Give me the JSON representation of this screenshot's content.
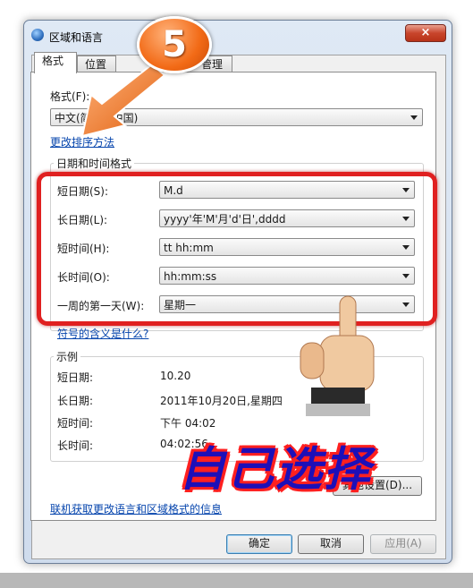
{
  "window": {
    "title": "区域和语言",
    "close_glyph": "×"
  },
  "tabs": [
    {
      "label": "格式"
    },
    {
      "label": "位置"
    },
    {
      "label": "管理"
    }
  ],
  "format": {
    "label": "格式(F):",
    "value": "中文(简体，中国)",
    "sort_link": "更改排序方法"
  },
  "datetime_group": {
    "title": "日期和时间格式",
    "rows": [
      {
        "label": "短日期(S):",
        "value": "M.d"
      },
      {
        "label": "长日期(L):",
        "value": "yyyy'年'M'月'd'日',dddd"
      },
      {
        "label": "短时间(H):",
        "value": "tt hh:mm"
      },
      {
        "label": "长时间(O):",
        "value": "hh:mm:ss"
      },
      {
        "label": "一周的第一天(W):",
        "value": "星期一"
      }
    ],
    "notation_link": "符号的含义是什么?"
  },
  "examples": {
    "title": "示例",
    "rows": [
      {
        "label": "短日期:",
        "value": "10.20"
      },
      {
        "label": "长日期:",
        "value": "2011年10月20日,星期四"
      },
      {
        "label": "短时间:",
        "value": "下午 04:02"
      },
      {
        "label": "长时间:",
        "value": "04:02:56"
      }
    ]
  },
  "other_settings_button": "其他设置(D)...",
  "online_link": "联机获取更改语言和区域格式的信息",
  "buttons": {
    "ok": "确定",
    "cancel": "取消",
    "apply": "应用(A)"
  },
  "annotations": {
    "step_number": "5",
    "caption": "自己选择"
  },
  "colors": {
    "highlight_red": "#e02020",
    "badge_orange": "#f26a16",
    "caption_blue": "#1d0fb8"
  }
}
